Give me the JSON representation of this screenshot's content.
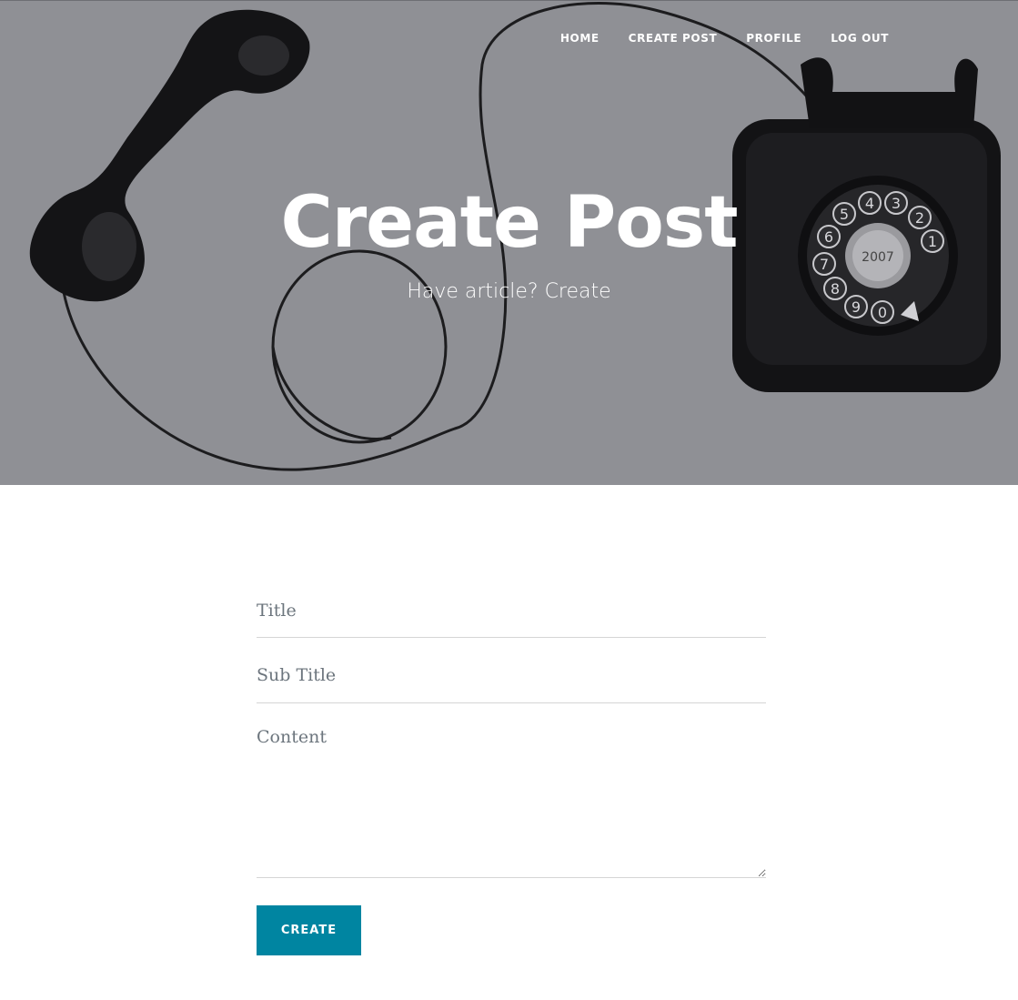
{
  "nav": {
    "items": [
      {
        "label": "HOME"
      },
      {
        "label": "CREATE POST"
      },
      {
        "label": "PROFILE"
      },
      {
        "label": "LOG OUT"
      }
    ]
  },
  "hero": {
    "title": "Create Post",
    "subtitle": "Have article? Create",
    "phone_dial_digits": [
      "5",
      "4",
      "3",
      "2",
      "1",
      "6",
      "7",
      "8",
      "9",
      "0"
    ],
    "phone_label": "2007"
  },
  "form": {
    "title_placeholder": "Title",
    "subtitle_placeholder": "Sub Title",
    "content_placeholder": "Content",
    "submit_label": "CREATE"
  },
  "colors": {
    "hero_overlay": "#8f9095",
    "button": "#0085a1"
  }
}
